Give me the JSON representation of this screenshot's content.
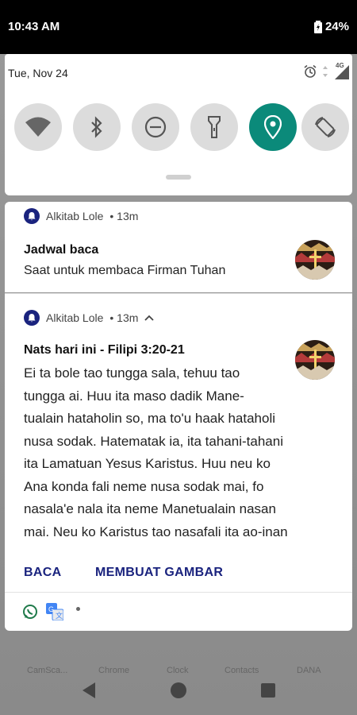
{
  "status_bar": {
    "time": "10:43 AM",
    "battery": "24%"
  },
  "quick_settings": {
    "date": "Tue, Nov 24",
    "network_label": "4G",
    "tiles": [
      {
        "name": "wifi",
        "active": false
      },
      {
        "name": "bluetooth",
        "active": false
      },
      {
        "name": "do-not-disturb",
        "active": false
      },
      {
        "name": "flashlight",
        "active": false
      },
      {
        "name": "location",
        "active": true
      },
      {
        "name": "auto-rotate",
        "active": false
      }
    ]
  },
  "notification1": {
    "app": "Alkitab Lole",
    "time": "• 13m",
    "title": "Jadwal baca",
    "text": "Saat untuk membaca Firman Tuhan"
  },
  "notification2": {
    "app": "Alkitab Lole",
    "time": "• 13m",
    "title": "Nats hari ini - Filipi 3:20-21",
    "lines": [
      "Ei ta bole tao tungga sala, tehuu tao",
      "tungga ai. Huu ita maso dadik Mane-",
      "tualain hataholin so, ma to'u haak hataholi",
      "nusa sodak. Hatematak ia, ita tahani-tahani",
      "ita Lamatuan Yesus Karistus. Huu neu ko",
      "Ana konda fali neme nusa sodak mai, fo",
      "nasala'e nala ita neme Manetualain nasan",
      "mai. Neu ko Karistus tao nasafali ita ao-inan"
    ],
    "actions": [
      "BACA",
      "MEMBUAT GAMBAR"
    ]
  },
  "dock": {
    "labels": [
      "CamSca...",
      "Chrome",
      "Clock",
      "Contacts",
      "DANA"
    ]
  },
  "colors": {
    "accent": "#0b8a7a",
    "action": "#1a237e"
  }
}
